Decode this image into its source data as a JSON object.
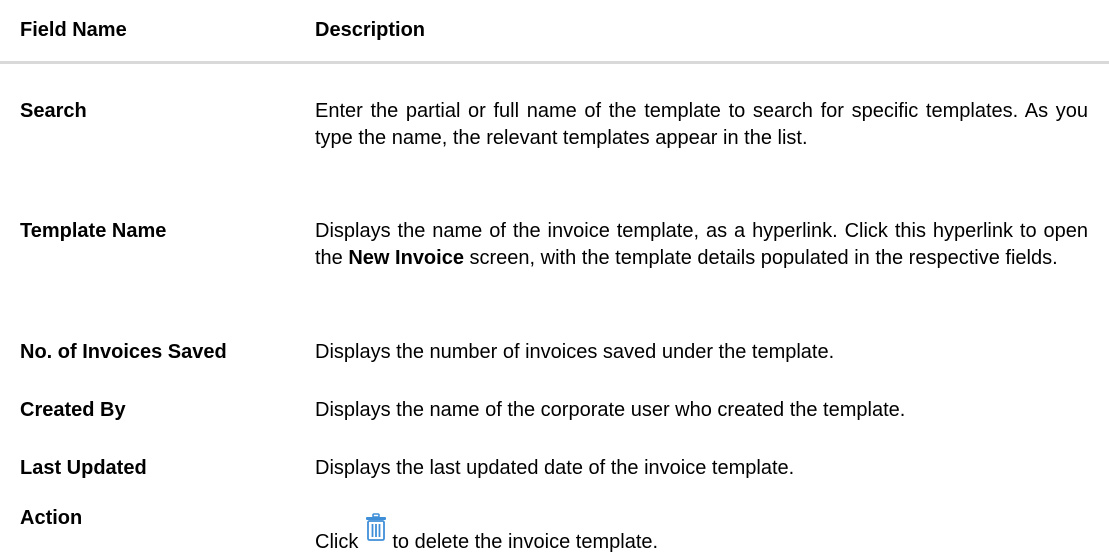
{
  "header": {
    "field_name": "Field Name",
    "description": "Description"
  },
  "rows": [
    {
      "field": "Search",
      "description": "Enter the partial or full name of the template to search for specific templates. As you type the name, the relevant templates appear in the list."
    },
    {
      "field": "Template Name",
      "description_before": "Displays the name of the invoice template, as a hyperlink. Click this hyperlink to open the ",
      "description_bold": "New Invoice",
      "description_after": " screen, with the template details populated in the respective fields."
    },
    {
      "field": "No. of Invoices Saved",
      "description": "Displays the number of invoices saved under the template."
    },
    {
      "field": "Created By",
      "description": "Displays the name of the corporate user who created the template."
    },
    {
      "field": "Last Updated",
      "description": "Displays the last updated date of the invoice template."
    },
    {
      "field": "Action",
      "description_before": "Click",
      "icon": "trash-icon",
      "description_after": "to delete the invoice template."
    }
  ],
  "colors": {
    "header_rule": "#d9d9d9",
    "icon": "#3f8fd8"
  }
}
